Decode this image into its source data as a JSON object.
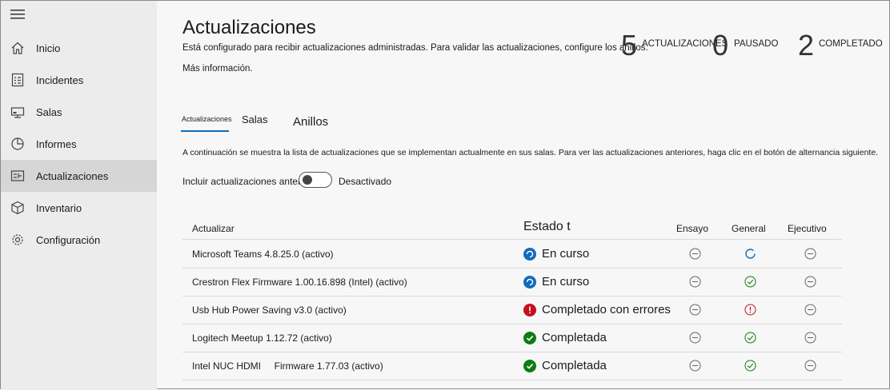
{
  "sidebar": {
    "items": [
      {
        "label": "Inicio",
        "icon": "home-icon"
      },
      {
        "label": "Incidentes",
        "icon": "checklist-icon"
      },
      {
        "label": "Salas",
        "icon": "room-icon"
      },
      {
        "label": "Informes",
        "icon": "pie-chart-icon"
      },
      {
        "label": "Actualizaciones",
        "icon": "updates-icon",
        "active": true
      },
      {
        "label": "Inventario",
        "icon": "box-icon"
      },
      {
        "label": "Configuración",
        "icon": "gear-icon"
      }
    ]
  },
  "header": {
    "title": "Actualizaciones",
    "description": "Está configurado para recibir actualizaciones administradas. Para validar las actualizaciones, configure los anillos.",
    "more_info": "Más información."
  },
  "stats": [
    {
      "value": "5",
      "label": "ACTUALIZACIONES"
    },
    {
      "value": "0",
      "label": "PAUSADO"
    },
    {
      "value": "2",
      "label": "COMPLETADO"
    }
  ],
  "tabs": [
    {
      "label": "Actualizaciones",
      "active": true
    },
    {
      "label": "Salas"
    },
    {
      "label": "Anillos"
    }
  ],
  "info_text": "A continuación se muestra la lista de actualizaciones que se implementan actualmente en sus salas. Para ver las actualizaciones anteriores, haga clic en el botón de alternancia siguiente.",
  "toggle": {
    "label": "Incluir actualizaciones anteriores",
    "state": "Desactivado"
  },
  "table": {
    "headers": {
      "name": "Actualizar",
      "status": "Estado t",
      "col1": "Ensayo",
      "col2": "General",
      "col3": "Ejecutivo"
    },
    "rows": [
      {
        "name": "Microsoft Teams 4.8.25.0 (activo)",
        "status": "En curso",
        "status_type": "progress",
        "rings": [
          "none",
          "progress",
          "none"
        ]
      },
      {
        "name": "Crestron Flex Firmware 1.00.16.898 (Intel) (activo)",
        "status": "En curso",
        "status_type": "progress",
        "rings": [
          "none",
          "done",
          "none"
        ]
      },
      {
        "name": "Usb Hub Power Saving v3.0 (activo)",
        "status": "Completado con errores",
        "status_type": "error",
        "rings": [
          "none",
          "error",
          "none"
        ]
      },
      {
        "name": "Logitech Meetup 1.12.72 (activo)",
        "status": "Completada",
        "status_type": "done",
        "rings": [
          "none",
          "done",
          "none"
        ]
      },
      {
        "name": "Intel NUC HDMI     Firmware 1.77.03 (activo)",
        "status": "Completada",
        "status_type": "done",
        "rings": [
          "none",
          "done",
          "none"
        ]
      }
    ]
  },
  "colors": {
    "accent": "#0f6cbd",
    "success": "#107c10",
    "error": "#c50f1f",
    "sidebar": "#ececec",
    "active_item": "#d6d6d6"
  }
}
